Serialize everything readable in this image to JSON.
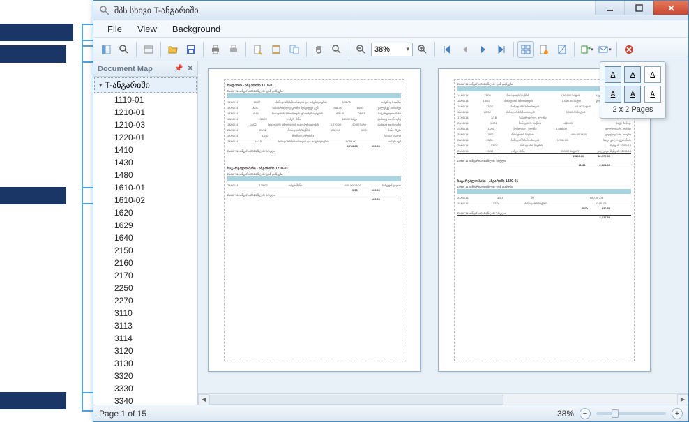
{
  "window": {
    "title": "შპს სხივი T-ანგარიში"
  },
  "menu": {
    "file": "File",
    "view": "View",
    "background": "Background"
  },
  "toolbar": {
    "zoom_value": "38%"
  },
  "docmap": {
    "title": "Document Map",
    "root": "T-ანგარიში",
    "items": [
      "1110-01",
      "1210-01",
      "1210-03",
      "1220-01",
      "1410",
      "1430",
      "1480",
      "1610-01",
      "1610-02",
      "1620",
      "1629",
      "1640",
      "2150",
      "2160",
      "2170",
      "2250",
      "2270",
      "3110",
      "3113",
      "3114",
      "3120",
      "3130",
      "3320",
      "3330",
      "3340"
    ]
  },
  "thumb_popup": {
    "label": "2 x 2 Pages",
    "cell_glyph": "A"
  },
  "pages": {
    "p1": {
      "section1_title": "სალარო - ანგარიში 1110-01",
      "section1_header": "Debit '11 იანვარი 2014 წლის' დან დაწყება",
      "section2_title": "საგარეალო მანი - ანგარიში 1210-01",
      "rows1": [
        [
          "18/01/14",
          "19/02",
          "ბინადარს ხმოისთვის და ოპერაციების",
          "628.05",
          "",
          "ოპერაც სათმო"
        ],
        [
          "17/01/14",
          "3/02",
          "საპასრ ხელფაკო მო შესყიდვა გენ",
          "-458.00",
          "14/03",
          "ვალენკე პარამუს"
        ],
        [
          "17/01/14",
          "14/15",
          "ბინადარს ხმოისთვის და ოპერაციების",
          "650.00",
          "08/03",
          "საგარეალო მანი"
        ],
        [
          "18/01/14",
          "130/02",
          "ოპერ მანი",
          "",
          "480.00 სატი",
          "გამთავ თიანოებუ"
        ],
        [
          "18/01/14",
          "14/02",
          "ბინადარს ხმოისთვის და ოპერაციების",
          "3,070.00",
          "50.00 სატი",
          "გამთავ თიანოებუ"
        ],
        [
          "21/01/14",
          "20/02",
          "ბინადარს საქმის",
          "880.00",
          "5/03",
          "მანი მსურ"
        ],
        [
          "27/01/14",
          "14/02",
          "მომსახ პერსონა",
          "",
          "",
          "სავაი ავაზევ"
        ],
        [
          "28/01/14",
          "14/15",
          "ბინადარს ხმოისთვის და ოპერაციების",
          "1,088.00",
          "",
          "ოპერ ავზ"
        ]
      ],
      "totals1_label": "Debit '11 იანვარი 2014 წლის' სრული",
      "totals1": [
        "5,716.05",
        "600.00"
      ],
      "rows2": [
        [
          "28/01/14",
          "130/02",
          "ოპერ მანი",
          "",
          "-400.00 14/03",
          "სახელმ ვალო"
        ]
      ],
      "totals2_label": "Debit '11 იანვარი 2014 წლის' სრული",
      "totals2": [
        "0.00",
        "100.00"
      ],
      "totals2b": [
        "100.00"
      ]
    },
    "p2": {
      "section1_header": "Debit '11 იანვარი 2014 წლის' დან დაწყება",
      "section3_title": "საგარეალო მანი - ანგარიში 1220-01",
      "rows1": [
        [
          "14/01/14",
          "13/01",
          "ბინადარს საქმის",
          "",
          "4,964.00 სატი8",
          "საყიველ ქაფხანა საჰაერო"
        ],
        [
          "18/01/14",
          "13/02",
          "ბინადარს ხმოისთვის",
          "",
          "1,060.00 სატი7",
          "კრედიტი სახელმ ვალენკე"
        ],
        [
          "18/01/14",
          "13/02",
          "ბინადარს ხმოისთვის",
          "",
          "43.00 სატი8",
          "ლეოგვილი ქაფი"
        ],
        [
          "18/01/14",
          "13/02",
          "ბინადარს ხმოისთვის",
          "",
          "3,050.00 სატი6",
          "გამთავინი საჰა 024516"
        ],
        [
          "17/01/14",
          "3/18",
          "საგარეალო - ვლენა",
          "",
          "",
          "კრედიტორი"
        ],
        [
          "20/01/14",
          "11/01",
          "ბინადარს საქმის",
          "-480.00",
          "",
          "სატი ბინად"
        ],
        [
          "24/01/14",
          "11/01",
          "შემდეგო - ვლენა",
          "1,086.00",
          "",
          "ვიქლიე$არ - თნება"
        ],
        [
          "28/01/14",
          "13/02",
          "ბინადარს საქმის",
          "",
          "-480.00 14/01",
          "ვიქლიე$არ - თნება"
        ],
        [
          "28/01/14",
          "13/01",
          "ბინადარს ხმოისთვის",
          "1,780.00",
          "",
          "სატი ვალო ტერინარ"
        ],
        [
          "29/01/14",
          "13/02",
          "ბინადარს საქმის",
          "",
          "",
          "შემფას 22/01/14"
        ],
        [
          "29/01/14",
          "13/02",
          "ოპერ მანი",
          "",
          "950.00 სატი27",
          "ვალენტი შემფას 22/01/14"
        ]
      ],
      "totals1": [
        "2,896.00",
        "12,977.55"
      ],
      "totals1b_label": "Debit '11 იანვარი 2014 წლის' სრული",
      "totals1b": [
        "11.32",
        "2,121.65"
      ],
      "rows3": [
        [
          "24/01/14",
          "11/01",
          "შმ",
          "",
          "880.00 /01",
          ""
        ],
        [
          "28/01/14",
          "13/01",
          "ბინადარს საქმის",
          "",
          "0.48 /01",
          ""
        ]
      ],
      "totals3_label": "Debit '11 იანვარი 2014 წლის' სრული",
      "totals3": [
        "0.00",
        "830.55"
      ],
      "totals3b": [
        "2,127.55"
      ]
    }
  },
  "status": {
    "page_label": "Page 1 of 15",
    "zoom_label": "38%"
  }
}
